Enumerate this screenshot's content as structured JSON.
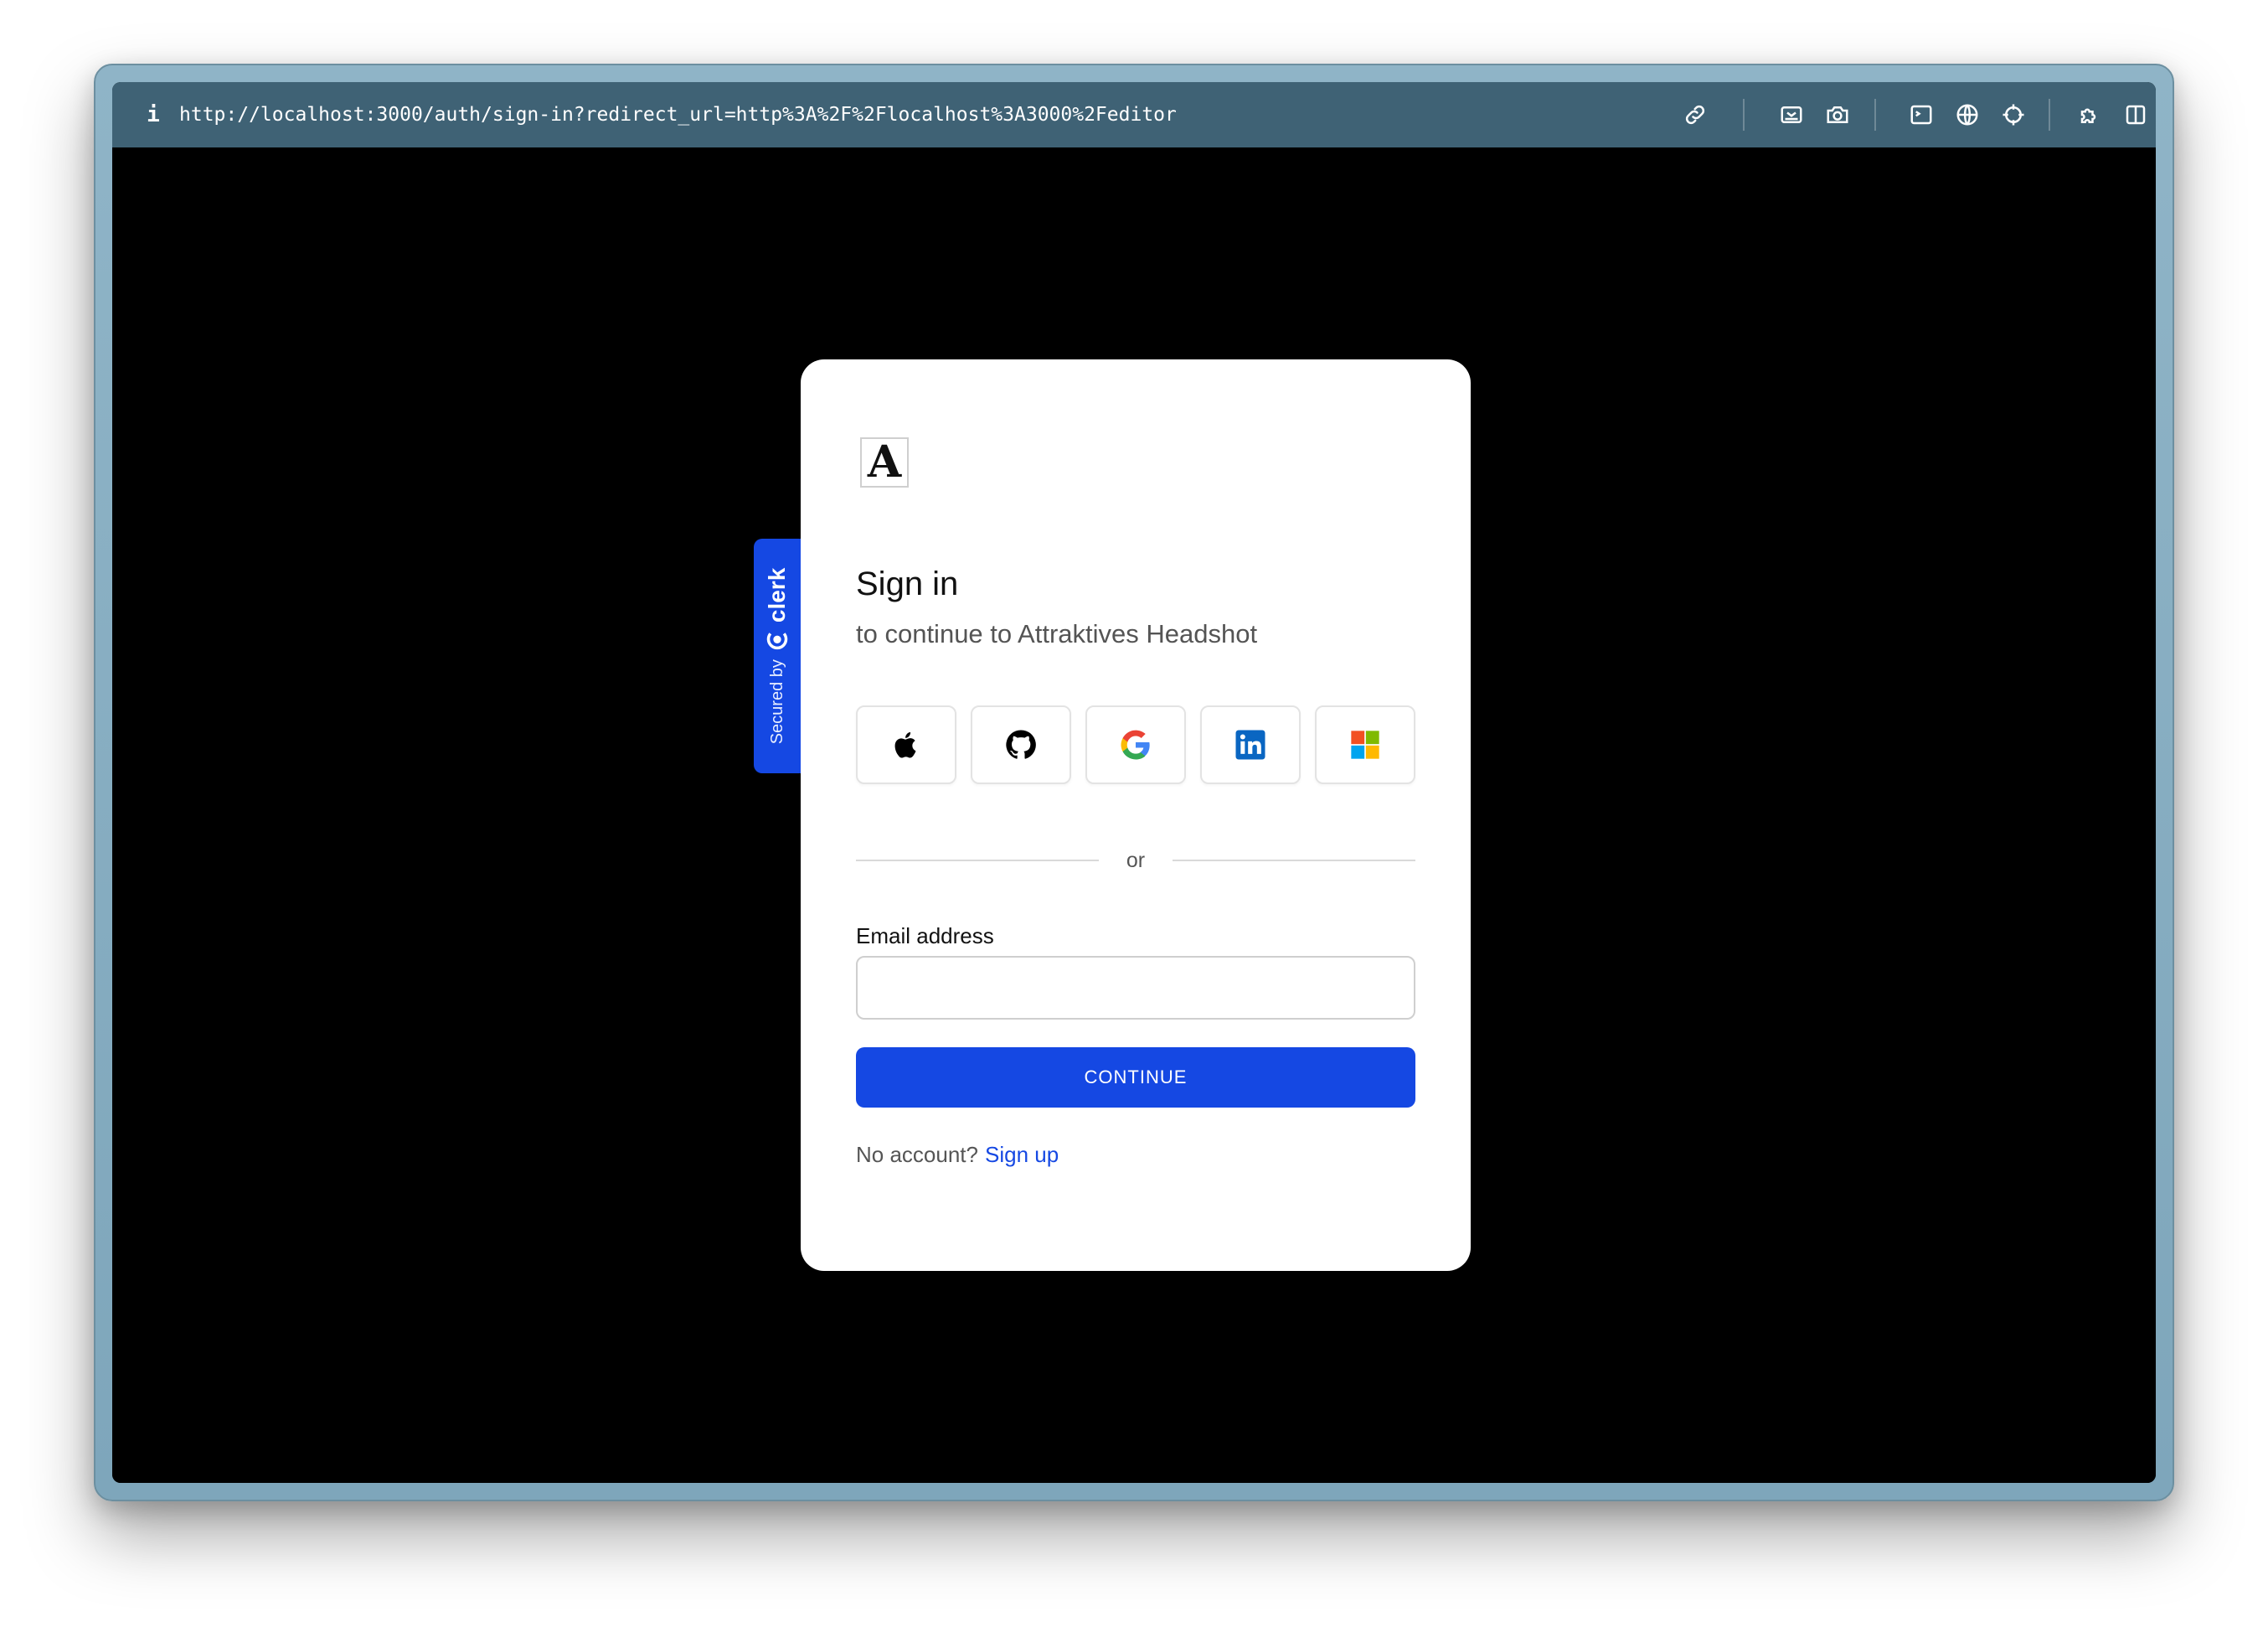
{
  "browser": {
    "url": "http://localhost:3000/auth/sign-in?redirect_url=http%3A%2F%2Flocalhost%3A3000%2Feditor",
    "info_icon": "i",
    "toolbar_icons": [
      "link-icon",
      "responsive-icon",
      "camera-icon",
      "terminal-icon",
      "globe-icon",
      "crosshair-icon",
      "puzzle-icon",
      "split-view-icon"
    ]
  },
  "clerk_badge": {
    "secured_label": "Secured by",
    "brand": "clerk"
  },
  "signin": {
    "logo_letter": "A",
    "title": "Sign in",
    "subtitle": "to continue to Attraktives Headshot",
    "social_providers": [
      "apple",
      "github",
      "google",
      "linkedin",
      "microsoft"
    ],
    "divider_text": "or",
    "email_label": "Email address",
    "email_value": "",
    "email_placeholder": "",
    "continue_label": "CONTINUE",
    "no_account_text": "No account?",
    "signup_label": "Sign up"
  },
  "colors": {
    "primary": "#1548e3",
    "toolbar": "#3f6275",
    "frame": "#8fb4c7",
    "background": "#000000"
  }
}
